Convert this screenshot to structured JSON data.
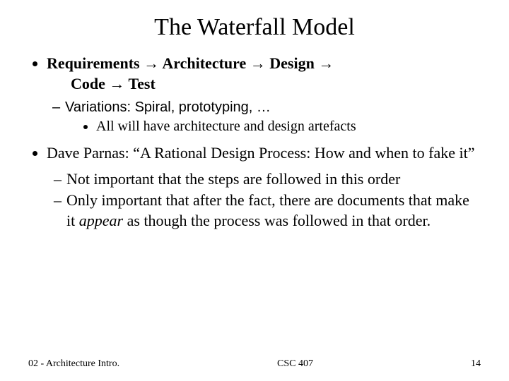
{
  "title": "The Waterfall Model",
  "bullet1": {
    "line1": "Requirements → Architecture → Design →",
    "line2": "Code → Test",
    "sub_dash": "Variations: Spiral, prototyping, …",
    "sub_bullet": "All will have architecture and design artefacts"
  },
  "bullet2": {
    "text": "Dave Parnas: “A Rational Design Process: How and when to fake it”",
    "sub1": "Not important that the steps are followed in this order",
    "sub2_pre": "Only important that after the fact, there are documents that make it ",
    "sub2_em": "appear",
    "sub2_post": " as though the process was followed in that order."
  },
  "footer": {
    "left": "02 - Architecture Intro.",
    "center": "CSC 407",
    "right": "14"
  }
}
